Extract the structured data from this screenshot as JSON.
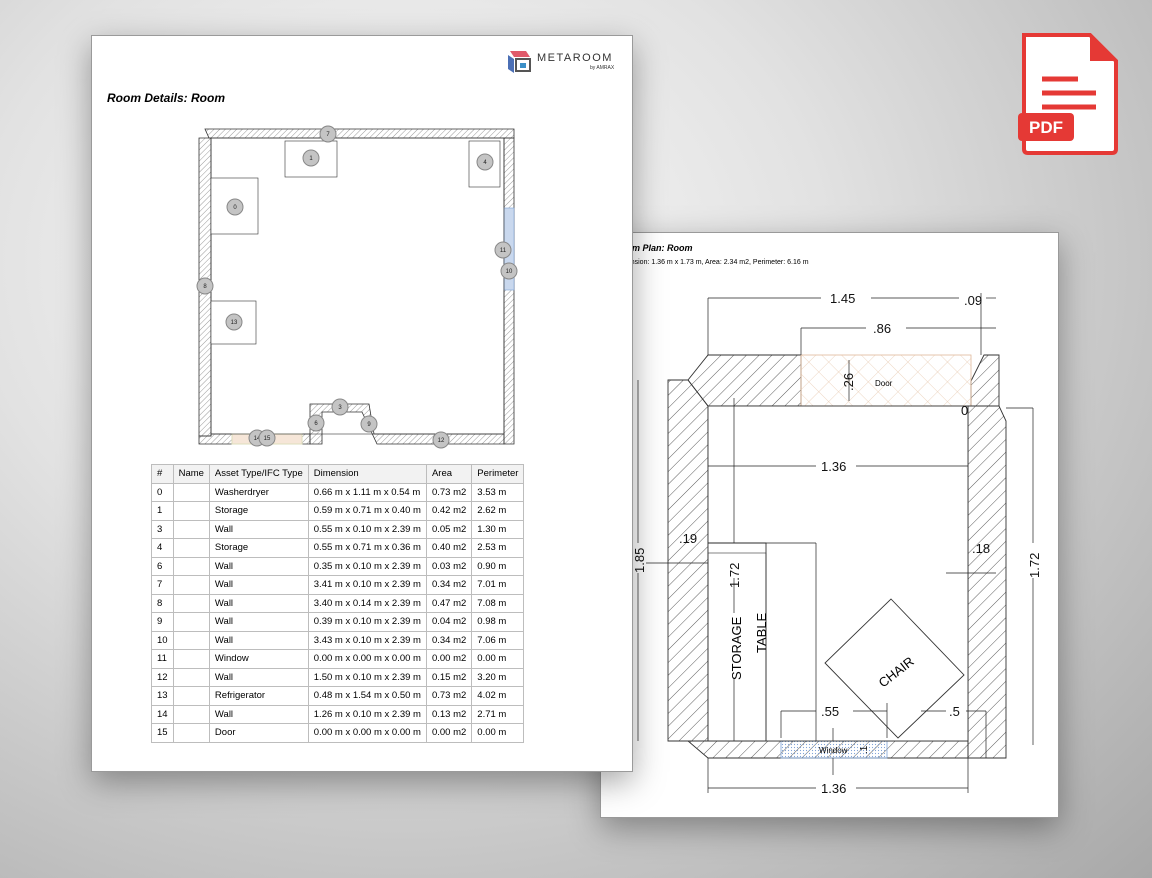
{
  "room_plan": {
    "title": "oom Plan: Room",
    "subtitle": "mension: 1.36 m x 1.73 m, Area: 2.34 m2, Perimeter: 6.16 m",
    "dims": {
      "top_outer": "1.45",
      "top_right": ".09",
      "door_width": ".86",
      "door_depth": ".26",
      "zero": "0",
      "inner_width": "1.36",
      "left_total": "1.85",
      "storage_height": "1.72",
      "left_wall": ".19",
      "right_wall": ".18",
      "right_total": "1.72",
      "window_width": ".55",
      "window_depth": ".1",
      "right_gap": ".5",
      "bottom_width": "1.36"
    },
    "labels": {
      "door": "Door",
      "storage": "STORAGE",
      "table": "TABLE",
      "chair": "CHAIR",
      "window": "Window"
    }
  },
  "room_details": {
    "title": "Room Details: Room",
    "logo_text": "METAROOM",
    "logo_by": "by AMRAX",
    "markers": [
      "0",
      "1",
      "3",
      "4",
      "6",
      "7",
      "8",
      "9",
      "10",
      "11",
      "12",
      "13",
      "14",
      "15"
    ],
    "table": {
      "headers": [
        "#",
        "Name",
        "Asset Type/IFC Type",
        "Dimension",
        "Area",
        "Perimeter"
      ],
      "rows": [
        [
          "0",
          "",
          "Washerdryer",
          "0.66 m x 1.11 m x 0.54 m",
          "0.73 m2",
          "3.53 m"
        ],
        [
          "1",
          "",
          "Storage",
          "0.59 m x 0.71 m x 0.40 m",
          "0.42 m2",
          "2.62 m"
        ],
        [
          "3",
          "",
          "Wall",
          "0.55 m x 0.10 m x 2.39 m",
          "0.05 m2",
          "1.30 m"
        ],
        [
          "4",
          "",
          "Storage",
          "0.55 m x 0.71 m x 0.36 m",
          "0.40 m2",
          "2.53 m"
        ],
        [
          "6",
          "",
          "Wall",
          "0.35 m x 0.10 m x 2.39 m",
          "0.03 m2",
          "0.90 m"
        ],
        [
          "7",
          "",
          "Wall",
          "3.41 m x 0.10 m x 2.39 m",
          "0.34 m2",
          "7.01 m"
        ],
        [
          "8",
          "",
          "Wall",
          "3.40 m x 0.14 m x 2.39 m",
          "0.47 m2",
          "7.08 m"
        ],
        [
          "9",
          "",
          "Wall",
          "0.39 m x 0.10 m x 2.39 m",
          "0.04 m2",
          "0.98 m"
        ],
        [
          "10",
          "",
          "Wall",
          "3.43 m x 0.10 m x 2.39 m",
          "0.34 m2",
          "7.06 m"
        ],
        [
          "11",
          "",
          "Window",
          "0.00 m x 0.00 m x 0.00 m",
          "0.00 m2",
          "0.00 m"
        ],
        [
          "12",
          "",
          "Wall",
          "1.50 m x 0.10 m x 2.39 m",
          "0.15 m2",
          "3.20 m"
        ],
        [
          "13",
          "",
          "Refrigerator",
          "0.48 m x 1.54 m x 0.50 m",
          "0.73 m2",
          "4.02 m"
        ],
        [
          "14",
          "",
          "Wall",
          "1.26 m x 0.10 m x 2.39 m",
          "0.13 m2",
          "2.71 m"
        ],
        [
          "15",
          "",
          "Door",
          "0.00 m x 0.00 m x 0.00 m",
          "0.00 m2",
          "0.00 m"
        ]
      ]
    }
  },
  "pdf_icon": {
    "label": "PDF",
    "color": "#e53935"
  }
}
